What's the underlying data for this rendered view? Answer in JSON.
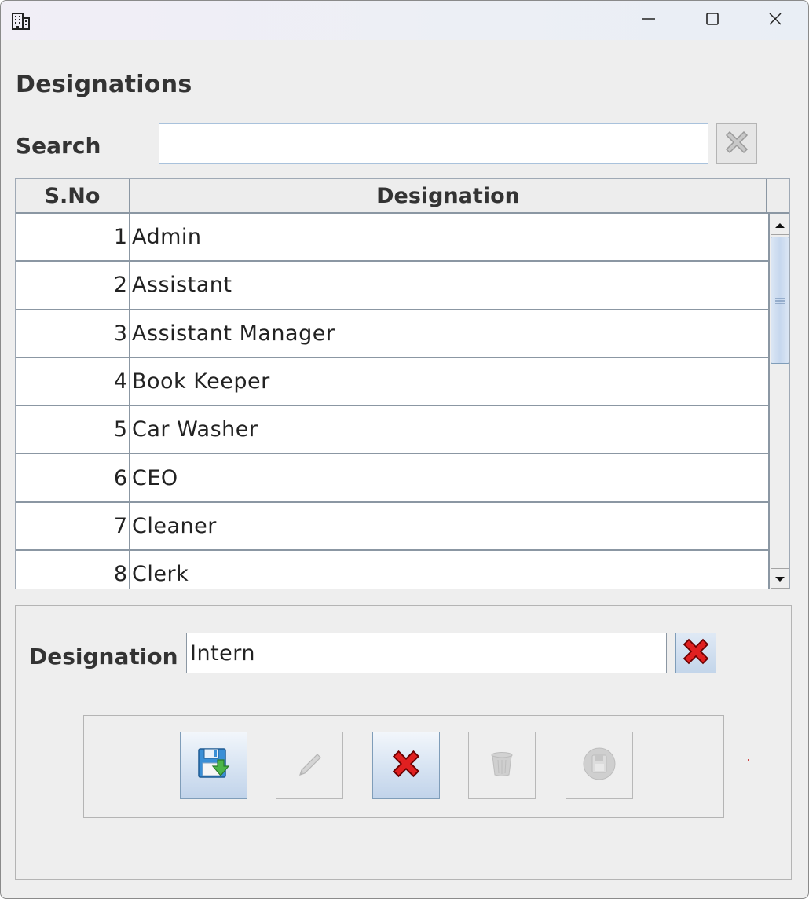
{
  "window": {
    "title": "",
    "controls": {
      "minimize": "minimize-icon",
      "maximize": "maximize-icon",
      "close": "close-icon"
    },
    "app_icon": "building-icon"
  },
  "page": {
    "heading": "Designations"
  },
  "search": {
    "label": "Search",
    "value": "",
    "placeholder": "",
    "clear_icon": "clear-x-icon"
  },
  "table": {
    "columns": [
      "S.No",
      "Designation"
    ],
    "rows": [
      {
        "sno": "1",
        "name": "Admin"
      },
      {
        "sno": "2",
        "name": "Assistant"
      },
      {
        "sno": "3",
        "name": "Assistant Manager"
      },
      {
        "sno": "4",
        "name": "Book Keeper"
      },
      {
        "sno": "5",
        "name": "Car Washer"
      },
      {
        "sno": "6",
        "name": "CEO"
      },
      {
        "sno": "7",
        "name": "Cleaner"
      },
      {
        "sno": "8",
        "name": "Clerk"
      }
    ]
  },
  "form": {
    "label": "Designation",
    "value": "Intern",
    "clear_icon": "red-x-icon"
  },
  "actions": {
    "save": {
      "icon": "save-disk-icon",
      "enabled": true
    },
    "edit": {
      "icon": "pencil-icon",
      "enabled": false
    },
    "cancel": {
      "icon": "red-x-icon",
      "enabled": true
    },
    "delete": {
      "icon": "trash-icon",
      "enabled": false
    },
    "print": {
      "icon": "disk-icon",
      "enabled": false
    }
  },
  "colors": {
    "window_bg": "#eeeeee",
    "table_grid": "#8b97a3",
    "button_gradient_end": "#c1d3ea",
    "accent_red": "#e02020"
  }
}
